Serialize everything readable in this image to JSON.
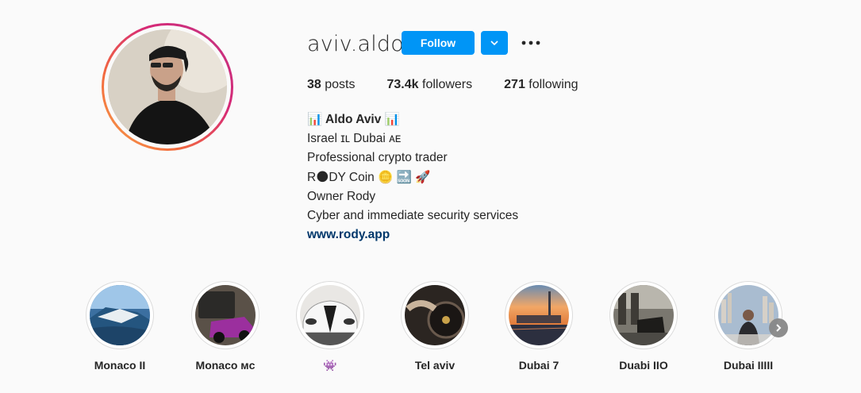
{
  "profile": {
    "username": "aviv.aldo",
    "follow_label": "Follow",
    "posts_count": "38",
    "posts_label": "posts",
    "followers_count": "73.4k",
    "followers_label": "followers",
    "following_count": "271",
    "following_label": "following"
  },
  "bio": {
    "name": "📊 Aldo Aviv 📊",
    "lines": [
      "Israel ɪʟ Dubai ᴀᴇ",
      "Professional crypto trader",
      "R🌑DY Coin 🪙 🔜 🚀",
      "Owner Rody",
      "Cyber and immediate security services"
    ],
    "link": "www.rody.app"
  },
  "highlights": [
    {
      "label": "Monaco II"
    },
    {
      "label": "Monaco ᴍᴄ"
    },
    {
      "label": "👾"
    },
    {
      "label": "Tel aviv"
    },
    {
      "label": "Dubai 7"
    },
    {
      "label": "Duabi IIO"
    },
    {
      "label": "Dubai IIIII"
    }
  ],
  "colors": {
    "accent": "#0095f6",
    "link": "#00376b",
    "text": "#262626",
    "background": "#fafafa"
  }
}
